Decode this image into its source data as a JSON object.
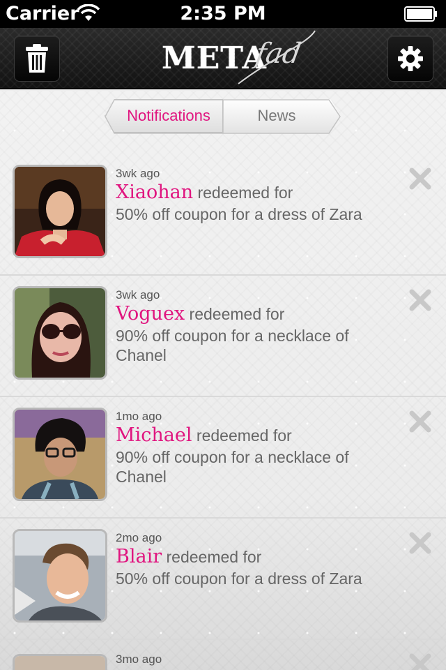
{
  "status_bar": {
    "carrier": "Carrier",
    "time": "2:35 PM"
  },
  "nav_bar": {
    "logo_main": "META",
    "logo_script": "fad",
    "left_icon": "trash-icon",
    "right_icon": "gear-icon"
  },
  "tabs": [
    {
      "label": "Notifications",
      "selected": true
    },
    {
      "label": "News",
      "selected": false
    }
  ],
  "accent_color": "#e0157f",
  "notifications": [
    {
      "time": "3wk ago",
      "name": "Xiaohan",
      "action": "redeemed for",
      "description": "50% off coupon for a dress of Zara"
    },
    {
      "time": "3wk ago",
      "name": "Voguex",
      "action": "redeemed for",
      "description": "90% off coupon for a necklace of Chanel"
    },
    {
      "time": "1mo ago",
      "name": "Michael",
      "action": "redeemed for",
      "description": "90% off coupon for a necklace of Chanel"
    },
    {
      "time": "2mo ago",
      "name": "Blair",
      "action": "redeemed for",
      "description": "50% off coupon for a dress of Zara"
    },
    {
      "time": "3mo ago"
    }
  ]
}
